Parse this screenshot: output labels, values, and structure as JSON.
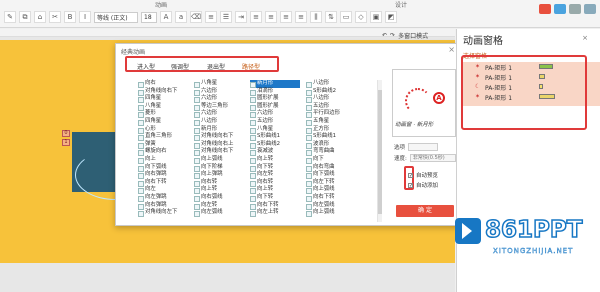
{
  "ribbon": {
    "tab_animation": "动画",
    "tab_design": "设计",
    "font_name": "等线 (正文)",
    "font_size": "18"
  },
  "subtoolbar": {
    "mode_label": "多窗口模式"
  },
  "dialog": {
    "title": "经典动画",
    "tabs": [
      "进入型",
      "强调型",
      "退出型",
      "路径型"
    ],
    "active_tab": 3,
    "columns": [
      [
        "向右",
        "对角线向右下",
        "四角星",
        "八角星",
        "菱形",
        "四角星",
        "心形",
        "直角三角形",
        "弹簧",
        "螺旋向右",
        "向上",
        "向下弧线",
        "向右弹跳",
        "向右下转",
        "向左",
        "向左弹跳",
        "向右弹跳",
        "对角线向左下"
      ],
      [
        "八角星",
        "六边形",
        "六边形",
        "等边三角形",
        "六边形",
        "八边形",
        "新月形",
        "对角线向右下",
        "对角线向右上",
        "对角线向右下",
        "向上弧线",
        "向下阶梯",
        "向上弹跳",
        "向右转",
        "向上转",
        "向右弧线",
        "向左转",
        "向左弧线"
      ],
      [
        "新月形",
        "泪滴形",
        "圆形扩展",
        "圆形扩展",
        "六边形",
        "五边形",
        "八角星",
        "S形曲线1",
        "S形曲线2",
        "衰减波",
        "向上转",
        "向下转",
        "向左转",
        "向右转",
        "向上转",
        "向下转",
        "向右下转",
        "向左上转"
      ],
      [
        "八边形",
        "S形曲线2",
        "八边形",
        "五边形",
        "平行四边形",
        "五角星",
        "正方形",
        "S形曲线1",
        "波浪形",
        "弯弯曲曲",
        "向下",
        "向右弯曲",
        "向下弧线",
        "向左下转",
        "向上弧线",
        "向右下转",
        "向左弧线",
        "向上弧线"
      ]
    ],
    "selected_item": "新月形",
    "preview_caption": "动画窗 · 新月形",
    "preview_glyph": "A",
    "options_label": "选项",
    "speed_label": "速度:",
    "speed_value": "非常快(0.5秒)",
    "auto_preview": "自动预览",
    "auto_add": "自动添加",
    "ok_label": "确 定"
  },
  "panel": {
    "title": "动画窗格",
    "selection_pane": "选择窗格",
    "items": [
      "PA-矩形 1",
      "PA-矩形 1",
      "PA-矩形 1",
      "PA-矩形 1"
    ]
  },
  "watermark": {
    "brand": "861PPT",
    "domain": "XITONGZHIJIA.NET"
  },
  "colors": {
    "accent_red": "#e03a3a",
    "slide_yellow": "#f7c23a",
    "shape_teal": "#2e5f74",
    "ok_red": "#e8503e"
  }
}
